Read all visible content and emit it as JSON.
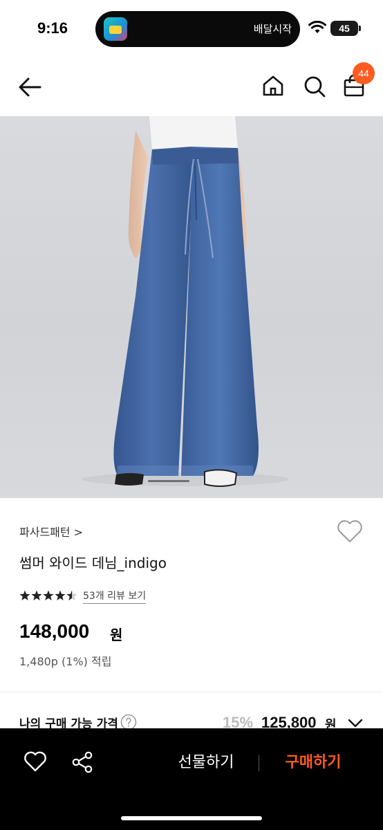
{
  "status_bar": {
    "time": "9:16",
    "island_text": "배달시작",
    "battery": "45"
  },
  "header": {
    "cart_count": "44"
  },
  "product": {
    "brand": "파사드패턴 >",
    "title": "썸머 와이드 데님_indigo",
    "rating": 4.5,
    "rating_max": 5,
    "review_link": "53개 리뷰 보기",
    "price": "148,000",
    "price_unit": "원",
    "points": "1,480p (1%) 적립"
  },
  "my_price": {
    "label": "나의 구매 가능 가격",
    "discount": "15%",
    "price": "125,800",
    "unit": "원"
  },
  "bottom_bar": {
    "gift_label": "선물하기",
    "buy_label": "구매하기"
  },
  "colors": {
    "accent": "#ff5a1f",
    "bottom_bar_bg": "#000000",
    "denim": "#3e62a0"
  },
  "icons": [
    "arrow-left-icon",
    "home-icon",
    "search-icon",
    "shopping-bag-icon",
    "heart-icon",
    "star-icon",
    "help-circle-icon",
    "chevron-down-icon",
    "share-icon"
  ]
}
